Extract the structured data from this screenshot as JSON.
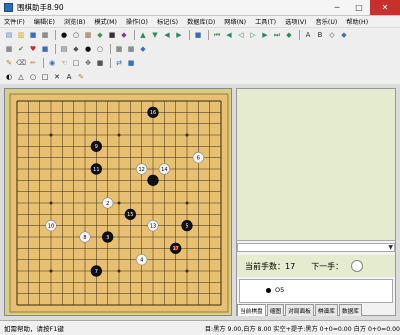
{
  "window": {
    "title": "围棋助手8.90",
    "minimize": "─",
    "maximize": "□",
    "close": "✕"
  },
  "menu": [
    "文件(F)",
    "编辑(E)",
    "浏览(B)",
    "模式(M)",
    "操作(O)",
    "标记(S)",
    "数据库(D)",
    "网络(N)",
    "工具(T)",
    "选项(V)",
    "音乐(U)",
    "帮助(H)"
  ],
  "toolbar1": [
    {
      "name": "new-icon",
      "glyph": "▤",
      "color": "#5b7fbf"
    },
    {
      "name": "open-icon",
      "glyph": "▥",
      "color": "#d4a017"
    },
    {
      "name": "save-icon",
      "glyph": "■",
      "color": "#3b6fb5"
    },
    {
      "name": "grid-icon",
      "glyph": "▦",
      "color": "#555"
    },
    {
      "name": "black-stone-icon",
      "glyph": "●",
      "color": "#111"
    },
    {
      "name": "white-stone-icon",
      "glyph": "○",
      "color": "#333"
    },
    {
      "name": "board-icon",
      "glyph": "▦",
      "color": "#8a6d3b"
    },
    {
      "name": "green-icon",
      "glyph": "◆",
      "color": "#3a9a3a"
    },
    {
      "name": "dark-icon",
      "glyph": "■",
      "color": "#333"
    },
    {
      "name": "purple-icon",
      "glyph": "◆",
      "color": "#7a3a9a"
    },
    {
      "name": "up-arrow-icon",
      "glyph": "▲",
      "color": "#2e8b57"
    },
    {
      "name": "down-arrow-icon",
      "glyph": "▼",
      "color": "#2e8b57"
    },
    {
      "name": "left-arrow-icon",
      "glyph": "◀",
      "color": "#2e8b57"
    },
    {
      "name": "right-arrow-icon",
      "glyph": "▶",
      "color": "#2e8b57"
    },
    {
      "name": "save2-icon",
      "glyph": "■",
      "color": "#3b6fb5"
    },
    {
      "name": "first-move-icon",
      "glyph": "⏮",
      "color": "#2e8b57"
    },
    {
      "name": "prev-fast-icon",
      "glyph": "◀",
      "color": "#2e8b57"
    },
    {
      "name": "prev-icon",
      "glyph": "◁",
      "color": "#2e8b57"
    },
    {
      "name": "next-icon",
      "glyph": "▷",
      "color": "#2e8b57"
    },
    {
      "name": "next-fast-icon",
      "glyph": "▶",
      "color": "#2e8b57"
    },
    {
      "name": "last-move-icon",
      "glyph": "⏭",
      "color": "#2e8b57"
    },
    {
      "name": "branch-icon",
      "glyph": "◆",
      "color": "#2e8b57"
    },
    {
      "name": "tool-a-icon",
      "glyph": "A",
      "color": "#333"
    },
    {
      "name": "tool-b-icon",
      "glyph": "B",
      "color": "#333"
    },
    {
      "name": "tool-c-icon",
      "glyph": "◇",
      "color": "#333"
    },
    {
      "name": "tool-d-icon",
      "glyph": "◆",
      "color": "#3a6fb5"
    }
  ],
  "toolbar2": [
    {
      "name": "stone-grid-icon",
      "glyph": "▦",
      "color": "#555"
    },
    {
      "name": "check-icon",
      "glyph": "✔",
      "color": "#3a9a3a"
    },
    {
      "name": "heart-icon",
      "glyph": "♥",
      "color": "#c03030"
    },
    {
      "name": "save3-icon",
      "glyph": "■",
      "color": "#3b6fb5"
    },
    {
      "name": "layer-icon",
      "glyph": "▤",
      "color": "#555"
    },
    {
      "name": "pin-icon",
      "glyph": "◆",
      "color": "#555"
    },
    {
      "name": "stone-black-icon",
      "glyph": "●",
      "color": "#111"
    },
    {
      "name": "stone-white-icon",
      "glyph": "○",
      "color": "#555"
    },
    {
      "name": "grid2-icon",
      "glyph": "▦",
      "color": "#555"
    },
    {
      "name": "grid3-icon",
      "glyph": "▦",
      "color": "#555"
    },
    {
      "name": "flag-icon",
      "glyph": "◆",
      "color": "#3a6fb5"
    }
  ],
  "toolbar3": [
    {
      "name": "brush-icon",
      "glyph": "✎",
      "color": "#c07a20"
    },
    {
      "name": "eraser-icon",
      "glyph": "⌫",
      "color": "#555"
    },
    {
      "name": "pencil-icon",
      "glyph": "✏",
      "color": "#c07a20"
    },
    {
      "name": "stone-select-icon",
      "glyph": "◉",
      "color": "#3a6fb5"
    },
    {
      "name": "hand-icon",
      "glyph": "☜",
      "color": "#555"
    },
    {
      "name": "square-tool-icon",
      "glyph": "□",
      "color": "#555"
    },
    {
      "name": "move-icon",
      "glyph": "✥",
      "color": "#555"
    },
    {
      "name": "fill-icon",
      "glyph": "■",
      "color": "#555"
    },
    {
      "name": "swap-icon",
      "glyph": "⇄",
      "color": "#3a6fb5"
    },
    {
      "name": "mark-icon",
      "glyph": "■",
      "color": "#3a6fb5"
    }
  ],
  "toolbar4": [
    {
      "name": "half-stone-icon",
      "glyph": "◐",
      "color": "#111"
    },
    {
      "name": "triangle-icon",
      "glyph": "△",
      "color": "#111"
    },
    {
      "name": "circle-icon",
      "glyph": "○",
      "color": "#111"
    },
    {
      "name": "square-icon",
      "glyph": "□",
      "color": "#111"
    },
    {
      "name": "cross-icon",
      "glyph": "✕",
      "color": "#111"
    },
    {
      "name": "label-a-icon",
      "glyph": "A",
      "color": "#111"
    },
    {
      "name": "erase-mark-icon",
      "glyph": "✎",
      "color": "#c07a20"
    }
  ],
  "board": {
    "size": 19,
    "stones": [
      {
        "c": "b",
        "x": 12,
        "y": 1,
        "n": "16"
      },
      {
        "c": "b",
        "x": 7,
        "y": 4,
        "n": "9"
      },
      {
        "c": "w",
        "x": 16,
        "y": 5,
        "n": "6"
      },
      {
        "c": "w",
        "x": 11,
        "y": 6,
        "n": "12"
      },
      {
        "c": "w",
        "x": 13,
        "y": 6,
        "n": "14"
      },
      {
        "c": "b",
        "x": 7,
        "y": 6,
        "n": "11"
      },
      {
        "c": "b",
        "x": 12,
        "y": 7,
        "n": ""
      },
      {
        "c": "w",
        "x": 8,
        "y": 9,
        "n": "2"
      },
      {
        "c": "b",
        "x": 10,
        "y": 10,
        "n": "15"
      },
      {
        "c": "w",
        "x": 3,
        "y": 11,
        "n": "10"
      },
      {
        "c": "w",
        "x": 12,
        "y": 11,
        "n": "13"
      },
      {
        "c": "b",
        "x": 15,
        "y": 11,
        "n": "5"
      },
      {
        "c": "w",
        "x": 6,
        "y": 12,
        "n": "8"
      },
      {
        "c": "b",
        "x": 8,
        "y": 12,
        "n": "3"
      },
      {
        "c": "b",
        "x": 14,
        "y": 13,
        "n": "17",
        "last": true
      },
      {
        "c": "w",
        "x": 11,
        "y": 14,
        "n": "4"
      },
      {
        "c": "b",
        "x": 7,
        "y": 15,
        "n": "7"
      }
    ]
  },
  "panel": {
    "move_count": "当前手数：17",
    "next_label": "下一手：",
    "move_entry": "O5",
    "tabs": [
      "当前棋盘",
      "缩图",
      "对局面板",
      "棋谱库",
      "数据库"
    ]
  },
  "status": {
    "help": "如需帮助，请按F1键",
    "info": "目:黑方  9.00,白方  8.00   实空+提子:黑方  0+0=0.00 白方  0+0=0.00"
  },
  "colors": {
    "board_bg": "#e8c072",
    "grid": "#3a2a10",
    "black": "#111111",
    "white": "#f4f4f4",
    "last_marker": "#cc2222"
  }
}
